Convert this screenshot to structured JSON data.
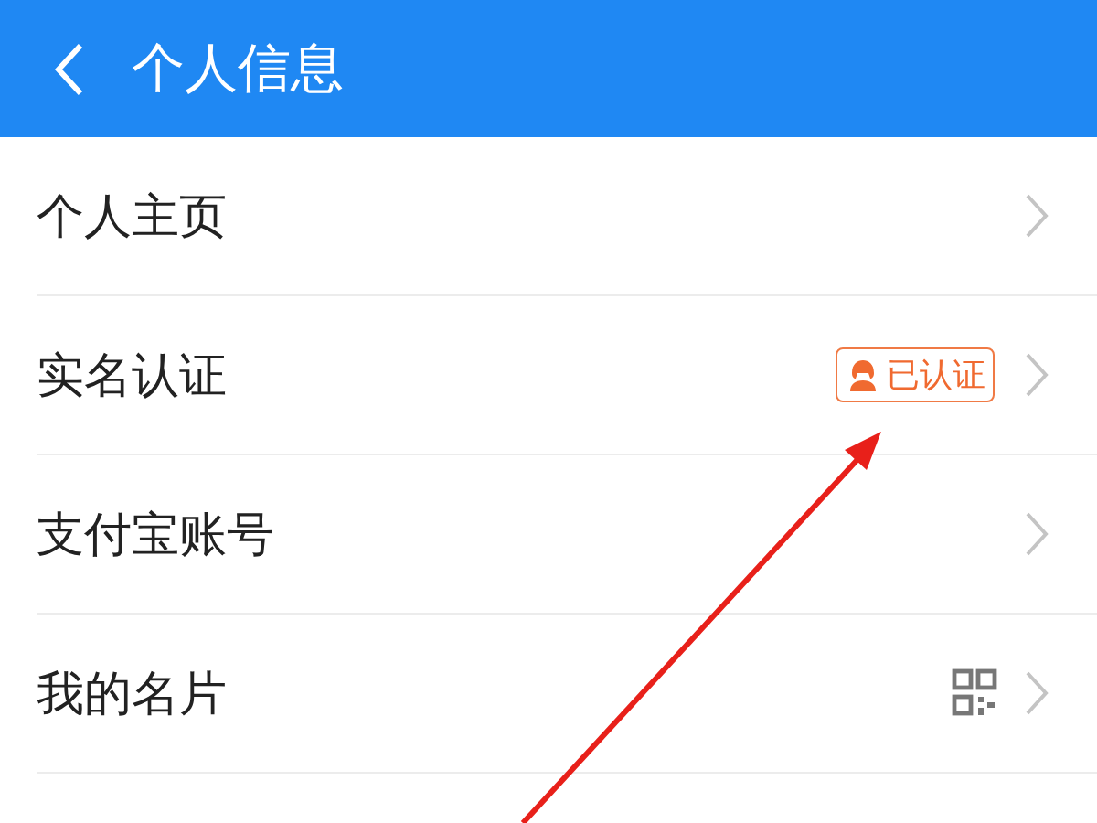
{
  "header": {
    "title": "个人信息"
  },
  "rows": [
    {
      "label": "个人主页",
      "kind": "plain"
    },
    {
      "label": "实名认证",
      "kind": "badge",
      "badge": "已认证"
    },
    {
      "label": "支付宝账号",
      "kind": "plain"
    },
    {
      "label": "我的名片",
      "kind": "qr"
    }
  ],
  "annotation": {
    "kind": "arrow"
  }
}
